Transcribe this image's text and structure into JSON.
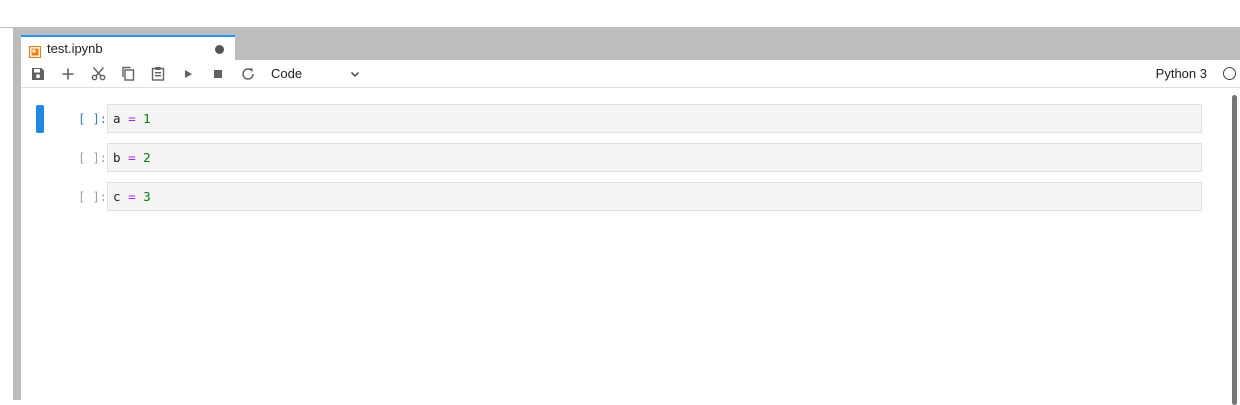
{
  "tab": {
    "title": "test.ipynb"
  },
  "toolbar": {
    "cell_type": "Code",
    "kernel_name": "Python 3",
    "buttons": [
      {
        "name": "save-button",
        "icon": "save-icon"
      },
      {
        "name": "insert-cell-button",
        "icon": "plus-icon"
      },
      {
        "name": "cut-button",
        "icon": "scissors-icon"
      },
      {
        "name": "copy-button",
        "icon": "copy-icon"
      },
      {
        "name": "paste-button",
        "icon": "paste-icon"
      },
      {
        "name": "run-button",
        "icon": "play-icon"
      },
      {
        "name": "interrupt-button",
        "icon": "stop-icon"
      },
      {
        "name": "restart-button",
        "icon": "refresh-icon"
      }
    ]
  },
  "cells": [
    {
      "prompt": "[ ]:",
      "var": "a",
      "op": "=",
      "num": "1",
      "active": true
    },
    {
      "prompt": "[ ]:",
      "var": "b",
      "op": "=",
      "num": "2",
      "active": false
    },
    {
      "prompt": "[ ]:",
      "var": "c",
      "op": "=",
      "num": "3",
      "active": false
    }
  ],
  "colors": {
    "accent": "#2196f3",
    "active_collapser": "#1e88e5",
    "active_prompt": "#307fc1",
    "operator": "#aa22ff",
    "number": "#008000",
    "notebook_icon": "#f57c00"
  }
}
